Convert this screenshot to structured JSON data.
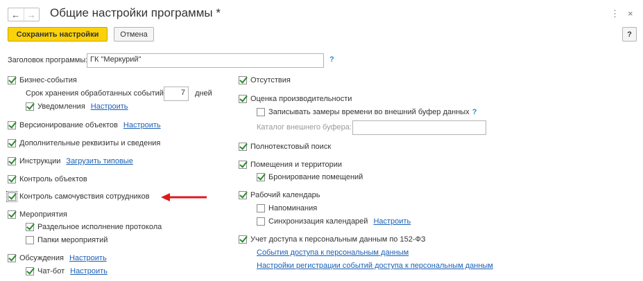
{
  "window": {
    "title": "Общие настройки программы *",
    "back_icon": "←",
    "forward_icon": "→",
    "more_icon": "⋮",
    "close_icon": "×"
  },
  "toolbar": {
    "save_label": "Сохранить настройки",
    "cancel_label": "Отмена",
    "help_label": "?"
  },
  "program_title": {
    "label": "Заголовок программы:",
    "value": "ГК \"Меркурий\"",
    "help": "?"
  },
  "left": {
    "business_events": "Бизнес-события",
    "retention_label": "Срок хранения обработанных событий:",
    "retention_value": "7",
    "retention_unit": "дней",
    "notifications": "Уведомления",
    "notifications_link": "Настроить",
    "versioning": "Версионирование объектов",
    "versioning_link": "Настроить",
    "additional_attrs": "Дополнительные реквизиты и сведения",
    "instructions": "Инструкции",
    "instructions_link": "Загрузить типовые",
    "objects_control": "Контроль объектов",
    "wellbeing_control": "Контроль самочувствия сотрудников",
    "events": "Мероприятия",
    "separate_protocol": "Раздельное исполнение протокола",
    "events_folders": "Папки мероприятий",
    "discussions": "Обсуждения",
    "discussions_link": "Настроить",
    "chatbot": "Чат-бот",
    "chatbot_link": "Настроить"
  },
  "right": {
    "absences": "Отсутствия",
    "performance": "Оценка производительности",
    "write_measurements": "Записывать замеры времени во внешний буфер данных",
    "write_help": "?",
    "buffer_catalog_label": "Каталог внешнего буфера:",
    "fulltext": "Полнотекстовый поиск",
    "premises": "Помещения и территории",
    "room_booking": "Бронирование помещений",
    "work_calendar": "Рабочий календарь",
    "reminders": "Напоминания",
    "calendar_sync": "Синхронизация календарей",
    "calendar_sync_link": "Настроить",
    "personal_data": "Учет доступа к персональным данным по 152-ФЗ",
    "pd_events_link": "События доступа к персональным данным",
    "pd_settings_link": "Настройки регистрации событий доступа к персональным данным"
  },
  "colors": {
    "primary_button": "#fbd20a",
    "link": "#1a5fb4",
    "check": "#2a8a2a",
    "arrow": "#e0191c"
  }
}
